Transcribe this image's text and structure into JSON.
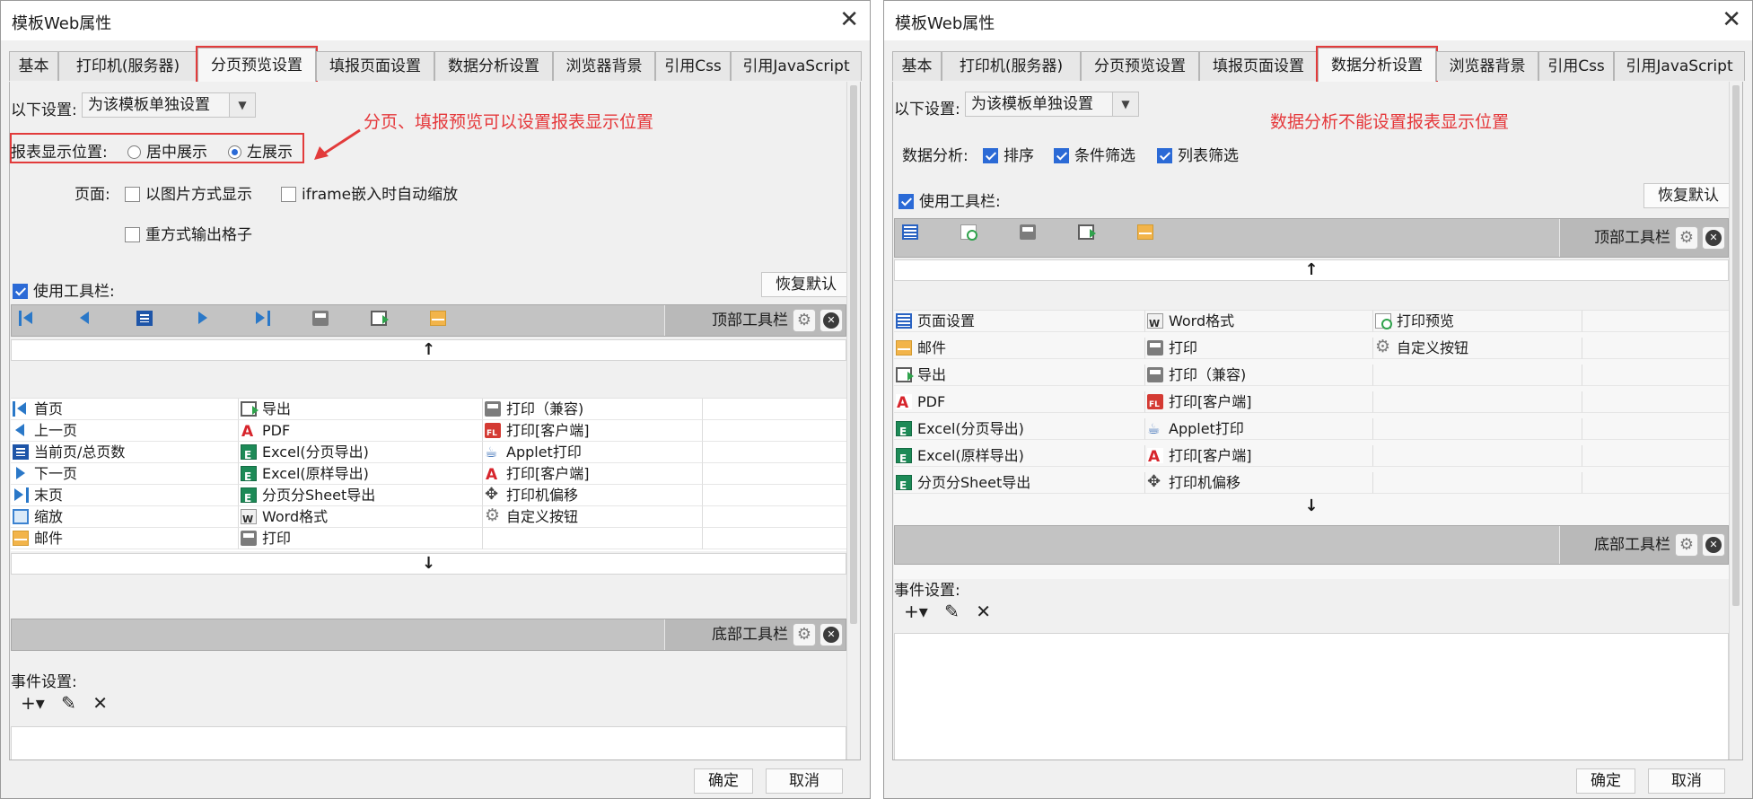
{
  "left": {
    "title": "模板Web属性",
    "tabs": [
      "基本",
      "打印机(服务器)",
      "分页预览设置",
      "填报页面设置",
      "数据分析设置",
      "浏览器背景",
      "引用Css",
      "引用JavaScript"
    ],
    "settings_label": "以下设置:",
    "settings_value": "为该模板单独设置",
    "annotation": "分页、填报预览可以设置报表显示位置",
    "display_position_label": "报表显示位置:",
    "radio_center": "居中展示",
    "radio_left": "左展示",
    "page_label": "页面:",
    "cb_image": "以图片方式显示",
    "cb_iframe": "iframe嵌入时自动缩放",
    "cb_heavy": "重方式输出格子",
    "use_toolbar": "使用工具栏:",
    "restore_default": "恢复默认",
    "top_toolbar": "顶部工具栏",
    "bottom_toolbar": "底部工具栏",
    "col1": [
      {
        "icon": "first-page-icon",
        "label": "首页"
      },
      {
        "icon": "prev-page-icon",
        "label": "上一页"
      },
      {
        "icon": "page-number-icon",
        "label": "当前页/总页数"
      },
      {
        "icon": "next-page-icon",
        "label": "下一页"
      },
      {
        "icon": "last-page-icon",
        "label": "末页"
      },
      {
        "icon": "zoom-icon",
        "label": "缩放"
      },
      {
        "icon": "mail-icon",
        "label": "邮件"
      }
    ],
    "col2": [
      {
        "icon": "export-icon",
        "label": "导出"
      },
      {
        "icon": "pdf-icon",
        "label": "PDF"
      },
      {
        "icon": "excel-icon",
        "label": "Excel(分页导出)"
      },
      {
        "icon": "excel-icon",
        "label": "Excel(原样导出)"
      },
      {
        "icon": "excel-icon",
        "label": "分页分Sheet导出"
      },
      {
        "icon": "word-icon",
        "label": "Word格式"
      },
      {
        "icon": "print-icon",
        "label": "打印"
      }
    ],
    "col3": [
      {
        "icon": "print-icon",
        "label": "打印（兼容)"
      },
      {
        "icon": "print-fl-icon",
        "label": "打印[客户端]"
      },
      {
        "icon": "java-icon",
        "label": "Applet打印"
      },
      {
        "icon": "pdf-print-icon",
        "label": "打印[客户端]"
      },
      {
        "icon": "move-icon",
        "label": "打印机偏移"
      },
      {
        "icon": "gear-icon",
        "label": "自定义按钮"
      }
    ],
    "events_label": "事件设置:",
    "ok": "确定",
    "cancel": "取消"
  },
  "right": {
    "title": "模板Web属性",
    "tabs": [
      "基本",
      "打印机(服务器)",
      "分页预览设置",
      "填报页面设置",
      "数据分析设置",
      "浏览器背景",
      "引用Css",
      "引用JavaScript"
    ],
    "settings_label": "以下设置:",
    "settings_value": "为该模板单独设置",
    "annotation": "数据分析不能设置报表显示位置",
    "analysis_label": "数据分析:",
    "cb_sort": "排序",
    "cb_condition": "条件筛选",
    "cb_column": "列表筛选",
    "use_toolbar": "使用工具栏:",
    "restore_default": "恢复默认",
    "top_toolbar": "顶部工具栏",
    "bottom_toolbar": "底部工具栏",
    "col1": [
      {
        "icon": "page-setup-icon",
        "label": "页面设置"
      },
      {
        "icon": "mail-icon",
        "label": "邮件"
      },
      {
        "icon": "export-icon",
        "label": "导出"
      },
      {
        "icon": "pdf-icon",
        "label": "PDF"
      },
      {
        "icon": "excel-icon",
        "label": "Excel(分页导出)"
      },
      {
        "icon": "excel-icon",
        "label": "Excel(原样导出)"
      },
      {
        "icon": "excel-icon",
        "label": "分页分Sheet导出"
      }
    ],
    "col2": [
      {
        "icon": "word-icon",
        "label": "Word格式"
      },
      {
        "icon": "print-icon",
        "label": "打印"
      },
      {
        "icon": "print-icon",
        "label": "打印（兼容)"
      },
      {
        "icon": "print-fl-icon",
        "label": "打印[客户端]"
      },
      {
        "icon": "java-icon",
        "label": "Applet打印"
      },
      {
        "icon": "pdf-print-icon",
        "label": "打印[客户端]"
      },
      {
        "icon": "move-icon",
        "label": "打印机偏移"
      }
    ],
    "col3": [
      {
        "icon": "print-preview-icon",
        "label": "打印预览"
      },
      {
        "icon": "gear-icon",
        "label": "自定义按钮"
      }
    ],
    "events_label": "事件设置:",
    "ok": "确定",
    "cancel": "取消"
  },
  "colors": {
    "accent": "#2b6ad6",
    "highlight": "#e23b3b",
    "toolbar_bg": "#b9b9b9"
  }
}
